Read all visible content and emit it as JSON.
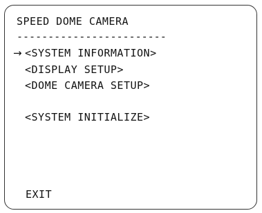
{
  "osd": {
    "title": "SPEED DOME CAMERA",
    "separator": "------------------------",
    "cursor": "→",
    "menu_items": [
      {
        "label": "<SYSTEM INFORMATION>",
        "selected": true
      },
      {
        "label": "<DISPLAY SETUP>",
        "selected": false
      },
      {
        "label": "<DOME CAMERA SETUP>",
        "selected": false
      },
      {
        "label": "<SYSTEM INITIALIZE>",
        "selected": false
      }
    ],
    "exit_label": "EXIT"
  },
  "colors": {
    "background": "#ffffff",
    "text": "#111111",
    "border": "#333333"
  }
}
